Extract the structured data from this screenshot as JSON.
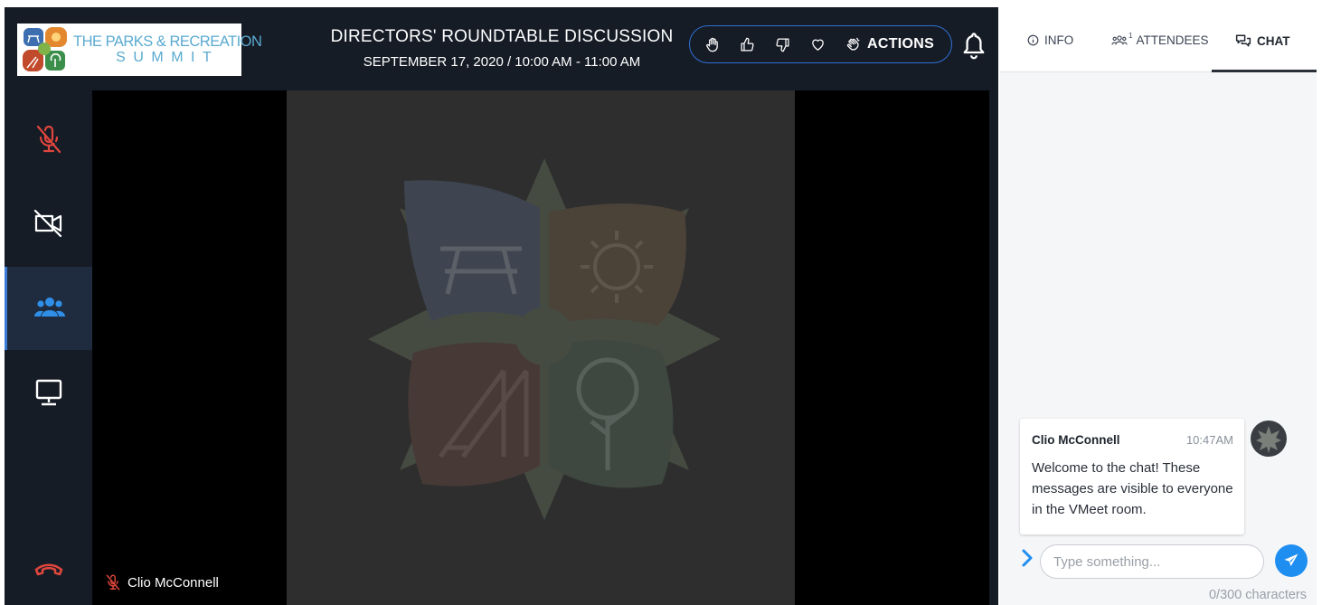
{
  "header": {
    "logo_line1": "THE PARKS & RECREATION",
    "logo_line2": "SUMMIT",
    "title": "DIRECTORS' ROUNDTABLE DISCUSSION",
    "schedule": "SEPTEMBER 17, 2020 / 10:00 AM - 11:00 AM",
    "actions": {
      "icons": [
        "raise-hand-icon",
        "thumbs-up-icon",
        "thumbs-down-icon",
        "heart-icon",
        "clap-icon"
      ],
      "label": "ACTIONS"
    },
    "bell_icon": "bell-icon"
  },
  "sidebar": {
    "tools": [
      {
        "name": "mic-muted-icon",
        "active": false
      },
      {
        "name": "camera-off-icon",
        "active": false
      },
      {
        "name": "participants-icon",
        "active": true
      },
      {
        "name": "screen-share-icon",
        "active": false
      },
      {
        "name": "hang-up-icon",
        "active": false
      }
    ]
  },
  "video": {
    "participant_name": "Clio McConnell"
  },
  "panel": {
    "tabs": [
      {
        "label": "INFO",
        "icon": "info-icon"
      },
      {
        "label": "ATTENDEES",
        "icon": "attendees-icon",
        "badge": "1"
      },
      {
        "label": "CHAT",
        "icon": "chat-icon",
        "active": true
      }
    ],
    "message": {
      "author": "Clio McConnell",
      "time": "10:47AM",
      "text": "Welcome to the chat! These messages are visible to everyone in the VMeet room."
    },
    "input_placeholder": "Type something...",
    "char_count": "0/300 characters"
  },
  "colors": {
    "app_bg": "#161c26",
    "accent_blue": "#2f6fd4",
    "send_blue": "#1f8ef1",
    "danger_red": "#e0463c"
  }
}
